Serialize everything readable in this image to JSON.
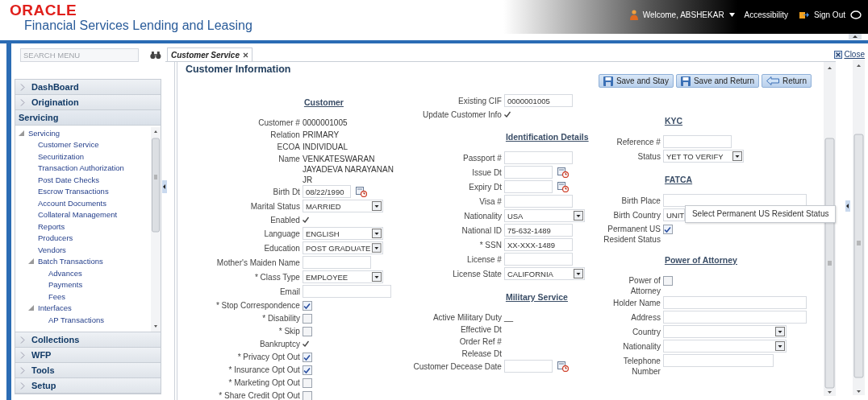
{
  "header": {
    "logo": "ORACLE",
    "product": "Financial Services Lending and Leasing",
    "welcome": "Welcome, ABSHEKAR",
    "accessibility": "Accessibility",
    "sign_out": "Sign Out"
  },
  "sidebar": {
    "search": {
      "placeholder": "SEARCH MENU"
    },
    "sections": [
      {
        "label": "DashBoard",
        "expanded": false
      },
      {
        "label": "Origination",
        "expanded": false
      },
      {
        "label": "Servicing",
        "expanded": true,
        "tree": [
          {
            "label": "Servicing",
            "expanded": true,
            "children": [
              {
                "label": "Customer Service"
              },
              {
                "label": "Securitization"
              },
              {
                "label": "Transaction Authorization"
              },
              {
                "label": "Post Date Checks"
              },
              {
                "label": "Escrow Transactions"
              },
              {
                "label": "Account Documents"
              },
              {
                "label": "Collateral Management"
              },
              {
                "label": "Reports"
              },
              {
                "label": "Producers"
              },
              {
                "label": "Vendors"
              },
              {
                "label": "Batch Transactions",
                "expanded": true,
                "children": [
                  {
                    "label": "Advances"
                  },
                  {
                    "label": "Payments"
                  },
                  {
                    "label": "Fees"
                  }
                ]
              },
              {
                "label": "Interfaces",
                "expanded": true,
                "children": [
                  {
                    "label": "AP Transactions"
                  }
                ]
              }
            ]
          }
        ]
      },
      {
        "label": "Collections",
        "expanded": false
      },
      {
        "label": "WFP",
        "expanded": false
      },
      {
        "label": "Tools",
        "expanded": false
      },
      {
        "label": "Setup",
        "expanded": false
      }
    ]
  },
  "tabs": [
    {
      "label": "Customer Service",
      "selected": true
    }
  ],
  "close": "Close",
  "title": "Customer Information",
  "buttons": [
    {
      "label": "Save and Stay",
      "kind": "save"
    },
    {
      "label": "Save and Return",
      "kind": "save"
    },
    {
      "label": "Return",
      "kind": "return"
    }
  ],
  "form": {
    "columns": [
      {
        "items": [
          {
            "kind": "heading",
            "label": "Customer"
          },
          {
            "kind": "value",
            "label": "Customer #",
            "value": "0000001005"
          },
          {
            "kind": "value",
            "label": "Relation",
            "value": "PRIMARY"
          },
          {
            "kind": "value",
            "label": "ECOA",
            "value": "INDIVIDUAL"
          },
          {
            "kind": "value",
            "label": "Name",
            "value": "VENKATESWARAN JAYADEVA NARAYANAN JR"
          },
          {
            "kind": "date",
            "label": "Birth Dt",
            "value": "08/22/1990"
          },
          {
            "kind": "select",
            "label": "Marital Status",
            "value": "MARRIED"
          },
          {
            "kind": "flag",
            "label": "Enabled",
            "on": true
          },
          {
            "kind": "select",
            "label": "Language",
            "value": "ENGLISH"
          },
          {
            "kind": "select",
            "label": "Education",
            "value": "POST GRADUATE"
          },
          {
            "kind": "input",
            "label": "Mother's Maiden Name"
          },
          {
            "kind": "select",
            "label": "* Class Type",
            "value": "EMPLOYEE"
          },
          {
            "kind": "input",
            "label": "Email"
          },
          {
            "kind": "check",
            "label": "* Stop Correspondence",
            "checked": true
          },
          {
            "kind": "check",
            "label": "* Disability",
            "checked": false
          },
          {
            "kind": "check",
            "label": "* Skip",
            "checked": false
          },
          {
            "kind": "flag",
            "label": "Bankruptcy",
            "on": true
          },
          {
            "kind": "check",
            "label": "* Privacy Opt Out",
            "checked": true
          },
          {
            "kind": "check",
            "label": "* Insurance Opt Out",
            "checked": true
          },
          {
            "kind": "check",
            "label": "* Marketing Opt Out",
            "checked": false
          },
          {
            "kind": "check",
            "label": "* Share Credit Opt Out",
            "checked": false
          }
        ]
      },
      {
        "items": [
          {
            "kind": "input",
            "label": "Existing CIF",
            "value": "0000001005"
          },
          {
            "kind": "flag",
            "label": "Update Customer Info",
            "on": true
          },
          {
            "kind": "heading",
            "label": "Identification Details"
          },
          {
            "kind": "input",
            "label": "Passport #"
          },
          {
            "kind": "date",
            "label": "Issue Dt"
          },
          {
            "kind": "date",
            "label": "Expiry Dt"
          },
          {
            "kind": "input",
            "label": "Visa #"
          },
          {
            "kind": "select",
            "label": "Nationality",
            "value": "USA"
          },
          {
            "kind": "input",
            "label": "National ID",
            "value": "75-632-1489"
          },
          {
            "kind": "input",
            "label": "* SSN",
            "value": "XX-XXX-1489"
          },
          {
            "kind": "input",
            "label": "License #"
          },
          {
            "kind": "select",
            "label": "License State",
            "value": "CALIFORNIA"
          },
          {
            "kind": "heading",
            "label": "Military Service"
          },
          {
            "kind": "value",
            "label": "Active Military Duty",
            "value": "__"
          },
          {
            "kind": "value",
            "label": "Effective Dt"
          },
          {
            "kind": "value",
            "label": "Order Ref #"
          },
          {
            "kind": "value",
            "label": "Release Dt"
          },
          {
            "kind": "date",
            "label": "Customer Decease Date"
          }
        ]
      },
      {
        "items": [
          {
            "kind": "heading",
            "label": "KYC"
          },
          {
            "kind": "input",
            "label": "Reference #"
          },
          {
            "kind": "select",
            "label": "Status",
            "value": "YET TO VERIFY"
          },
          {
            "kind": "heading",
            "label": "FATCA"
          },
          {
            "kind": "input",
            "label": "Birth Place"
          },
          {
            "kind": "input",
            "label": "Birth Country",
            "value": "UNIT",
            "tooltip": "Select Permanent US Resident Status"
          },
          {
            "kind": "check",
            "label": "Permanent US Resident Status",
            "checked": true
          },
          {
            "kind": "heading",
            "label": "Power of Attorney"
          },
          {
            "kind": "check",
            "label": "Power of Attorney",
            "checked": false
          },
          {
            "kind": "input",
            "label": "Holder Name"
          },
          {
            "kind": "input",
            "label": "Address"
          },
          {
            "kind": "select",
            "label": "Country"
          },
          {
            "kind": "select",
            "label": "Nationality"
          },
          {
            "kind": "input",
            "label": "Telephone Number"
          }
        ]
      }
    ]
  }
}
